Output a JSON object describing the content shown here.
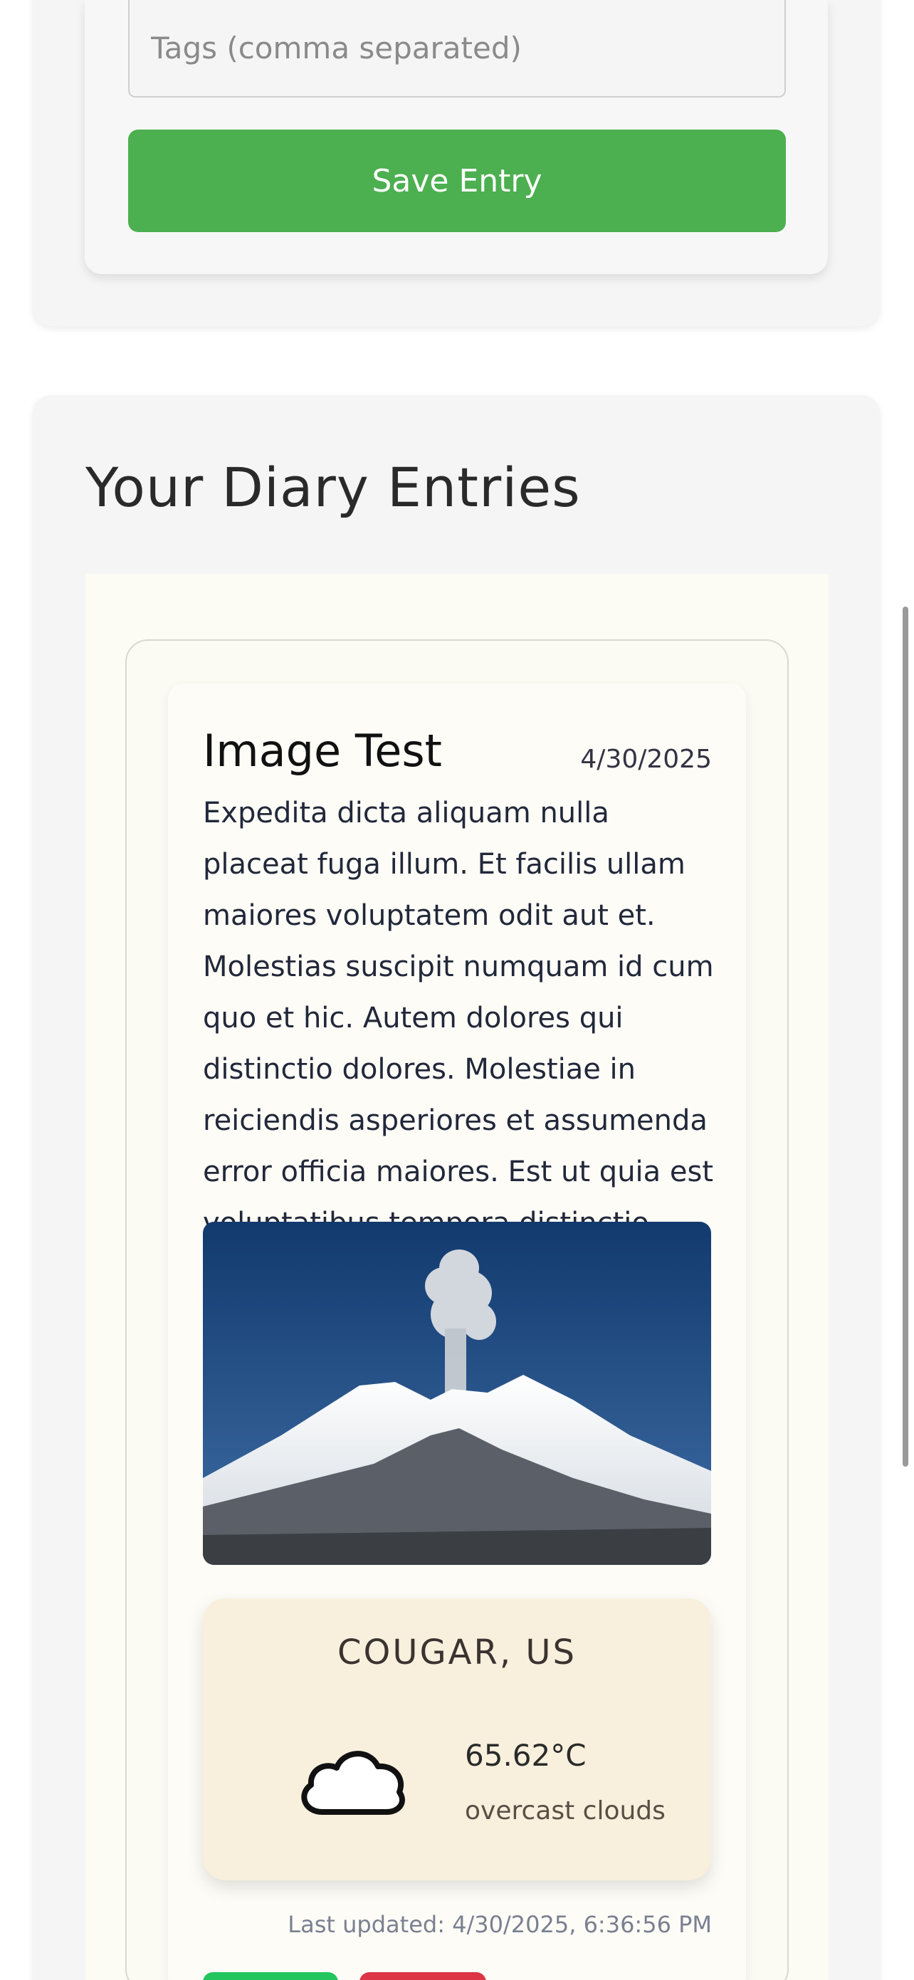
{
  "form": {
    "tags_placeholder": "Tags (comma separated)",
    "save_label": "Save Entry"
  },
  "entries_section": {
    "title": "Your Diary Entries"
  },
  "entry": {
    "title": "Image Test",
    "date": "4/30/2025",
    "body": "Expedita dicta aliquam nulla placeat fuga illum. Et facilis ullam maiores voluptatem odit aut et. Molestias suscipit numquam id cum quo et hic. Autem dolores qui distinctio dolores. Molestiae in reiciendis asperiores et assumenda error officia maiores. Est ut quia est voluptatibus tempora distinctio autem.",
    "image_icon": "volcano-photo"
  },
  "weather": {
    "location": "COUGAR, US",
    "icon": "cloud-icon",
    "temperature": "65.62°C",
    "description": "overcast clouds",
    "last_updated": "Last updated: 4/30/2025, 6:36:56 PM"
  },
  "colors": {
    "save_button": "#4caf50",
    "edit_button": "#22c55e",
    "delete_button": "#dc3545",
    "weather_card": "#f8f0dd"
  }
}
